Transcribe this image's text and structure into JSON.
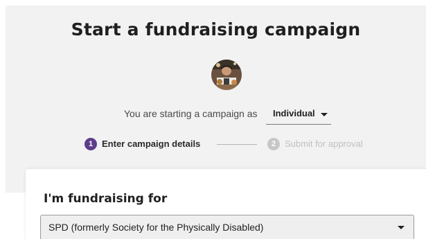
{
  "header": {
    "title": "Start a fundraising campaign"
  },
  "campaign_as": {
    "prefix": "You are starting a campaign as",
    "selected": "Individual"
  },
  "steps": [
    {
      "number": "1",
      "label": "Enter campaign details",
      "state": "active"
    },
    {
      "number": "2",
      "label": "Submit for approval",
      "state": "inactive"
    }
  ],
  "form": {
    "section_heading": "I'm fundraising for",
    "beneficiary": {
      "selected": "SPD (formerly Society for the Physically Disabled)"
    }
  },
  "colors": {
    "panel_background": "#f2f2f2",
    "accent": "#5c3c8c",
    "inactive_step": "#c7c7c7"
  },
  "icons": {
    "avatar": "user-avatar",
    "role_dropdown": "caret-down-icon",
    "beneficiary_dropdown": "caret-down-icon"
  }
}
